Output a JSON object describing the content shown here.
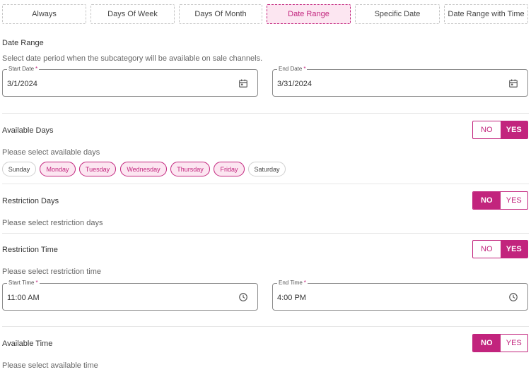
{
  "tabs": [
    "Always",
    "Days Of Week",
    "Days Of Month",
    "Date Range",
    "Specific Date",
    "Date Range with Time"
  ],
  "date_range": {
    "title": "Date Range",
    "hint": "Select date period when the subcategory will be available on sale channels.",
    "start_label": "Start Date",
    "start_value": "3/1/2024",
    "end_label": "End Date",
    "end_value": "3/31/2024",
    "required_mark": "*"
  },
  "available_days": {
    "title": "Available Days",
    "hint": "Please select available days",
    "no": "NO",
    "yes": "YES",
    "days": [
      "Sunday",
      "Monday",
      "Tuesday",
      "Wednesday",
      "Thursday",
      "Friday",
      "Saturday"
    ]
  },
  "restriction_days": {
    "title": "Restriction Days",
    "hint": "Please select restriction days",
    "no": "NO",
    "yes": "YES"
  },
  "restriction_time": {
    "title": "Restriction Time",
    "hint": "Please select restriction time",
    "no": "NO",
    "yes": "YES",
    "start_label": "Start Time",
    "start_value": "11:00 AM",
    "end_label": "End Time",
    "end_value": "4:00 PM",
    "required_mark": "*"
  },
  "available_time": {
    "title": "Available Time",
    "hint": "Please select available time",
    "no": "NO",
    "yes": "YES"
  },
  "accent_color": "#c2247d"
}
